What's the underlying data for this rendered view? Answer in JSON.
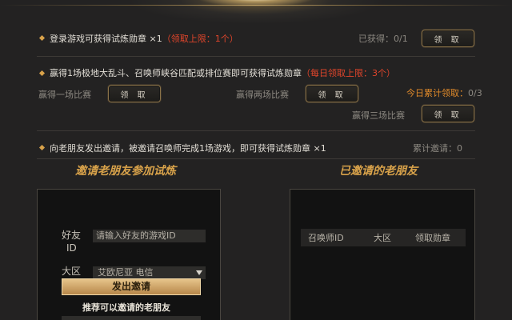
{
  "tasks": [
    {
      "text": "登录游戏可获得试炼勋章 ×1",
      "limit": "（领取上限：1个）",
      "counter": "已获得：0/1",
      "button": "领 取"
    },
    {
      "text": "赢得1场极地大乱斗、召唤师峡谷匹配或排位赛即可获得试炼勋章",
      "limit": "（每日领取上限：3个）",
      "counter_label": "今日累计领取：",
      "counter_value": "0/3",
      "sub": [
        {
          "label": "赢得一场比赛",
          "button": "领 取"
        },
        {
          "label": "赢得两场比赛",
          "button": "领 取"
        },
        {
          "label": "赢得三场比赛",
          "button": "领 取"
        }
      ]
    },
    {
      "text": "向老朋友发出邀请，被邀请召唤师完成1场游戏，即可获得试炼勋章 ×1",
      "counter": "累计邀请：0"
    }
  ],
  "invite_panel": {
    "title": "邀请老朋友参加试炼",
    "friend_label_line1": "好友",
    "friend_label_line2": "ID",
    "friend_placeholder": "请输入好友的游戏ID",
    "region_label": "大区",
    "region_value": "艾欧尼亚 电信",
    "send_button": "发出邀请",
    "recommend_title": "推荐可以邀请的老朋友"
  },
  "invited_panel": {
    "title": "已邀请的老朋友",
    "columns": [
      "召唤师ID",
      "大区",
      "领取勋章"
    ]
  },
  "colors": {
    "accent_gold": "#d8a24a",
    "limit_red": "#e0452b",
    "today_orange": "#e08a2a"
  }
}
